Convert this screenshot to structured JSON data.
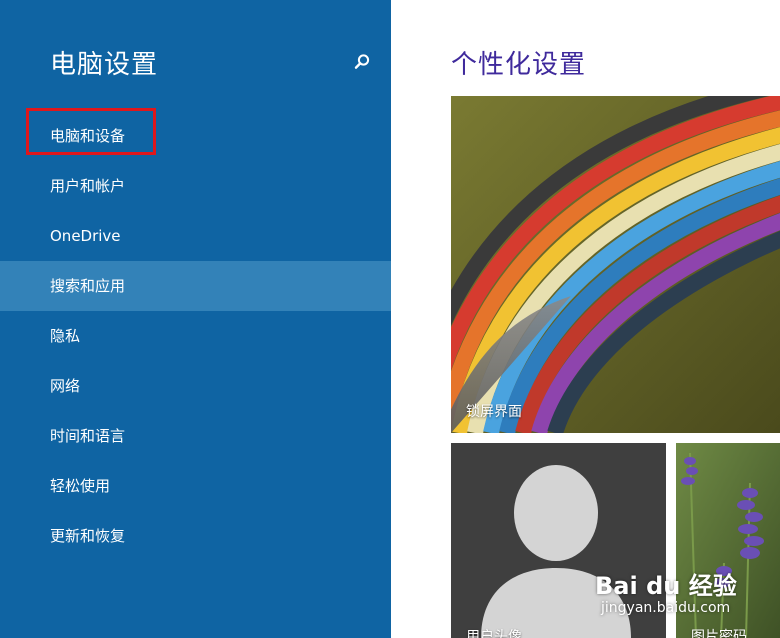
{
  "sidebar": {
    "title": "电脑设置",
    "search_icon": "search-icon",
    "items": [
      {
        "label": "电脑和设备",
        "highlighted": true
      },
      {
        "label": "用户和帐户"
      },
      {
        "label": "OneDrive"
      },
      {
        "label": "搜索和应用",
        "selected": true
      },
      {
        "label": "隐私"
      },
      {
        "label": "网络"
      },
      {
        "label": "时间和语言"
      },
      {
        "label": "轻松使用"
      },
      {
        "label": "更新和恢复"
      }
    ]
  },
  "main": {
    "title": "个性化设置",
    "tiles": [
      {
        "label": "锁屏界面"
      },
      {
        "label": "用户头像"
      },
      {
        "label": "图片密码"
      }
    ]
  },
  "watermark": {
    "logo": "Bai du 经验",
    "url": "jingyan.baidu.com"
  },
  "colors": {
    "sidebar_bg": "#0F64A3",
    "selected_bg": "#3382B8",
    "highlight_border": "#E0171C",
    "title_purple": "#3F2A9C"
  }
}
